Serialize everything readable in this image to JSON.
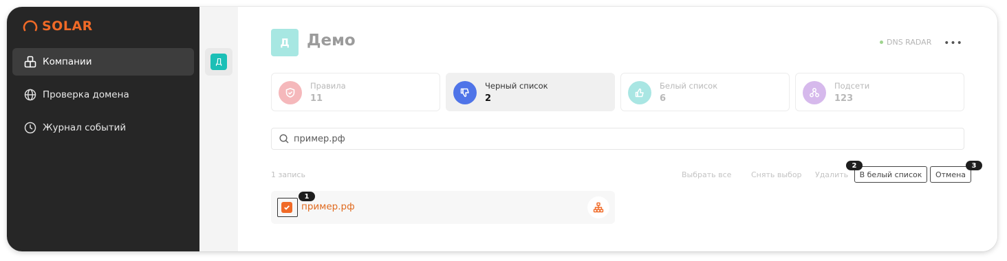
{
  "app": {
    "logo_text": "SOLAR",
    "brand_color": "#f06a27"
  },
  "sidebar": {
    "items": [
      {
        "label": "Компании",
        "icon": "building-icon",
        "active": true
      },
      {
        "label": "Проверка домена",
        "icon": "globe-icon",
        "active": false
      },
      {
        "label": "Журнал событий",
        "icon": "clock-icon",
        "active": false
      }
    ]
  },
  "company_strip": {
    "avatar_letter": "Д"
  },
  "header": {
    "avatar_letter": "Д",
    "title": "Демо",
    "status_label": "DNS RADAR",
    "more_label": "•••"
  },
  "stats": [
    {
      "label": "Правила",
      "value": "11",
      "icon": "shield-icon",
      "color": "#f5b8bb"
    },
    {
      "label": "Черный список",
      "value": "2",
      "icon": "thumbs-down-icon",
      "color": "#4f74e8"
    },
    {
      "label": "Белый список",
      "value": "6",
      "icon": "thumbs-up-icon",
      "color": "#a9e6e3"
    },
    {
      "label": "Подсети",
      "value": "123",
      "icon": "network-icon",
      "color": "#d6b9ec"
    }
  ],
  "search": {
    "value": "пример.рф",
    "placeholder": ""
  },
  "list_toolbar": {
    "count": "1 запись",
    "select_all": "Выбрать все",
    "deselect": "Снять выбор",
    "delete": "Удалить",
    "to_whitelist": "В белый список",
    "cancel": "Отмена"
  },
  "badges": {
    "b1": "1",
    "b2": "2",
    "b3": "3"
  },
  "rows": [
    {
      "domain": "пример.рф",
      "checked": true,
      "icon": "hierarchy-icon"
    }
  ]
}
